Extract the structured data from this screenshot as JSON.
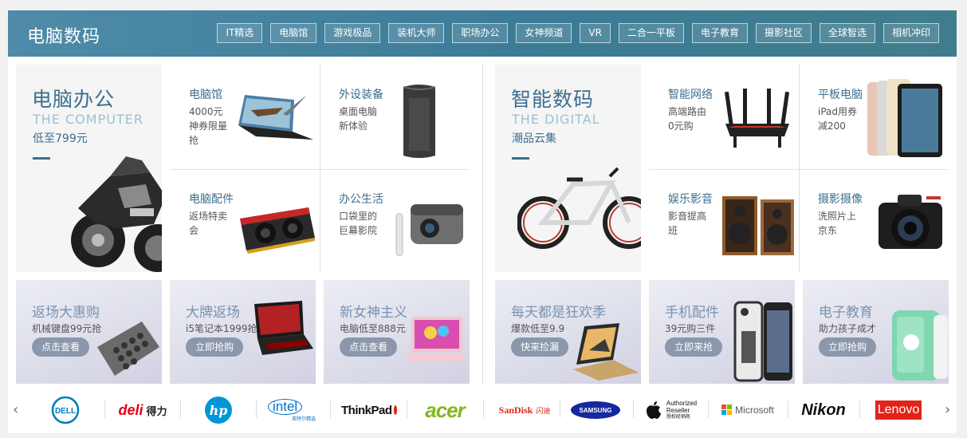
{
  "section_title": "电脑数码",
  "nav": [
    "IT精选",
    "电脑馆",
    "游戏极品",
    "装机大师",
    "职场办公",
    "女神频道",
    "VR",
    "二合一平板",
    "电子教育",
    "摄影社区",
    "全球智选",
    "相机冲印"
  ],
  "left_feature": {
    "title": "电脑办公",
    "en": "THE COMPUTER",
    "sub": "低至799元"
  },
  "right_feature": {
    "title": "智能数码",
    "en": "THE DIGITAL",
    "sub": "潮品云集"
  },
  "left_cells": [
    {
      "title": "电脑馆",
      "desc": "4000元神券限量抢"
    },
    {
      "title": "外设装备",
      "desc": "桌面电脑新体验"
    },
    {
      "title": "电脑配件",
      "desc": "返场特卖会"
    },
    {
      "title": "办公生活",
      "desc": "口袋里的巨幕影院"
    }
  ],
  "right_cells": [
    {
      "title": "智能网络",
      "desc": "高端路由0元购"
    },
    {
      "title": "平板电脑",
      "desc": "iPad用券减200"
    },
    {
      "title": "娱乐影音",
      "desc": "影音提高班"
    },
    {
      "title": "摄影摄像",
      "desc": "洗照片上京东"
    }
  ],
  "promos": [
    {
      "title": "返场大惠购",
      "desc": "机械键盘99元抢",
      "button": "点击查看"
    },
    {
      "title": "大牌返场",
      "desc": "i5笔记本1999抢",
      "button": "立即抢购"
    },
    {
      "title": "新女神主义",
      "desc": "电脑低至888元",
      "button": "点击查看"
    },
    {
      "title": "每天都是狂欢季",
      "desc": "爆款低至9.9",
      "button": "快来捡漏"
    },
    {
      "title": "手机配件",
      "desc": "39元购三件",
      "button": "立即来抢"
    },
    {
      "title": "电子教育",
      "desc": "助力孩子成才",
      "button": "立即抢购"
    }
  ],
  "brands": {
    "prev_arrow": "‹",
    "next_arrow": "›",
    "dell": "DELL",
    "deli": "deli",
    "deli_cn": "得力",
    "hp": "hp",
    "intel": "intel",
    "intel_tag": "英特尔精选",
    "thinkpad": "ThinkPad",
    "acer": "acer",
    "sandisk": "SanDisk",
    "sandisk_cn": "闪迪",
    "samsung": "SAMSUNG",
    "apple_line1": "Authorized",
    "apple_line2": "Reseller",
    "apple_line3": "授权经销商",
    "microsoft": "Microsoft",
    "nikon": "Nikon",
    "lenovo": "Lenovo"
  },
  "colors": {
    "bar": "#3e7d99",
    "accent": "#3b6f8f",
    "lenovo": "#e2231a",
    "acer": "#83b81a",
    "samsung": "#1428a0",
    "hp": "#0096d6",
    "dell": "#007db8",
    "deli": "#e60012"
  }
}
